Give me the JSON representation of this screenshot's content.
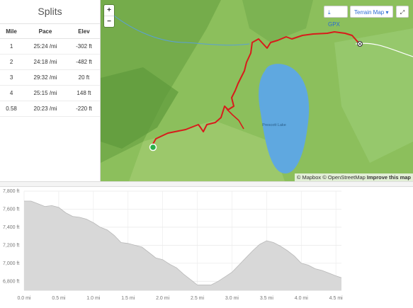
{
  "splits": {
    "title": "Splits",
    "columns": [
      "Mile",
      "Pace",
      "Elev"
    ],
    "rows": [
      {
        "mile": "1",
        "pace": "25:24 /mi",
        "elev": "-302 ft"
      },
      {
        "mile": "2",
        "pace": "24:18 /mi",
        "elev": "-482 ft"
      },
      {
        "mile": "3",
        "pace": "29:32 /mi",
        "elev": "20 ft"
      },
      {
        "mile": "4",
        "pace": "25:15 /mi",
        "elev": "148 ft"
      },
      {
        "mile": "0.58",
        "pace": "20:23 /mi",
        "elev": "-220 ft"
      }
    ]
  },
  "map": {
    "zoom_in": "+",
    "zoom_out": "−",
    "gpx_label": "GPX",
    "terrain_label": "Terrain Map",
    "attribution": "© Mapbox © OpenStreetMap",
    "improve_label": "Improve this map",
    "lake_label": "Prescott Lake",
    "route_color": "#d81b1b",
    "water_color": "#5fa8e0",
    "terrain_color": "#8cbf5c"
  },
  "chart_data": {
    "type": "area",
    "x_ticks": [
      "0.0 mi",
      "0.5 mi",
      "1.0 mi",
      "1.5 mi",
      "2.0 mi",
      "2.5 mi",
      "3.0 mi",
      "3.5 mi",
      "4.0 mi",
      "4.5 mi"
    ],
    "y_ticks": [
      "6,800 ft",
      "7,000 ft",
      "7,200 ft",
      "7,400 ft",
      "7,600 ft",
      "7,800 ft"
    ],
    "xlim": [
      0,
      4.58
    ],
    "ylim": [
      6700,
      7800
    ],
    "x": [
      0,
      0.1,
      0.2,
      0.3,
      0.4,
      0.5,
      0.6,
      0.7,
      0.8,
      0.9,
      1.0,
      1.1,
      1.2,
      1.3,
      1.4,
      1.5,
      1.6,
      1.7,
      1.8,
      1.9,
      2.0,
      2.1,
      2.2,
      2.3,
      2.4,
      2.5,
      2.6,
      2.7,
      2.8,
      2.9,
      3.0,
      3.1,
      3.2,
      3.3,
      3.4,
      3.5,
      3.6,
      3.7,
      3.8,
      3.9,
      4.0,
      4.1,
      4.2,
      4.3,
      4.4,
      4.5,
      4.58
    ],
    "y": [
      7690,
      7690,
      7660,
      7630,
      7640,
      7620,
      7560,
      7520,
      7510,
      7490,
      7450,
      7400,
      7370,
      7310,
      7230,
      7220,
      7200,
      7180,
      7120,
      7060,
      7040,
      6990,
      6950,
      6880,
      6820,
      6760,
      6760,
      6760,
      6800,
      6850,
      6900,
      6980,
      7060,
      7140,
      7210,
      7250,
      7230,
      7190,
      7140,
      7080,
      7000,
      6980,
      6940,
      6920,
      6890,
      6860,
      6840
    ],
    "fill_color": "#d8d8d8",
    "line_color": "#b8b8b8",
    "grid": true
  }
}
